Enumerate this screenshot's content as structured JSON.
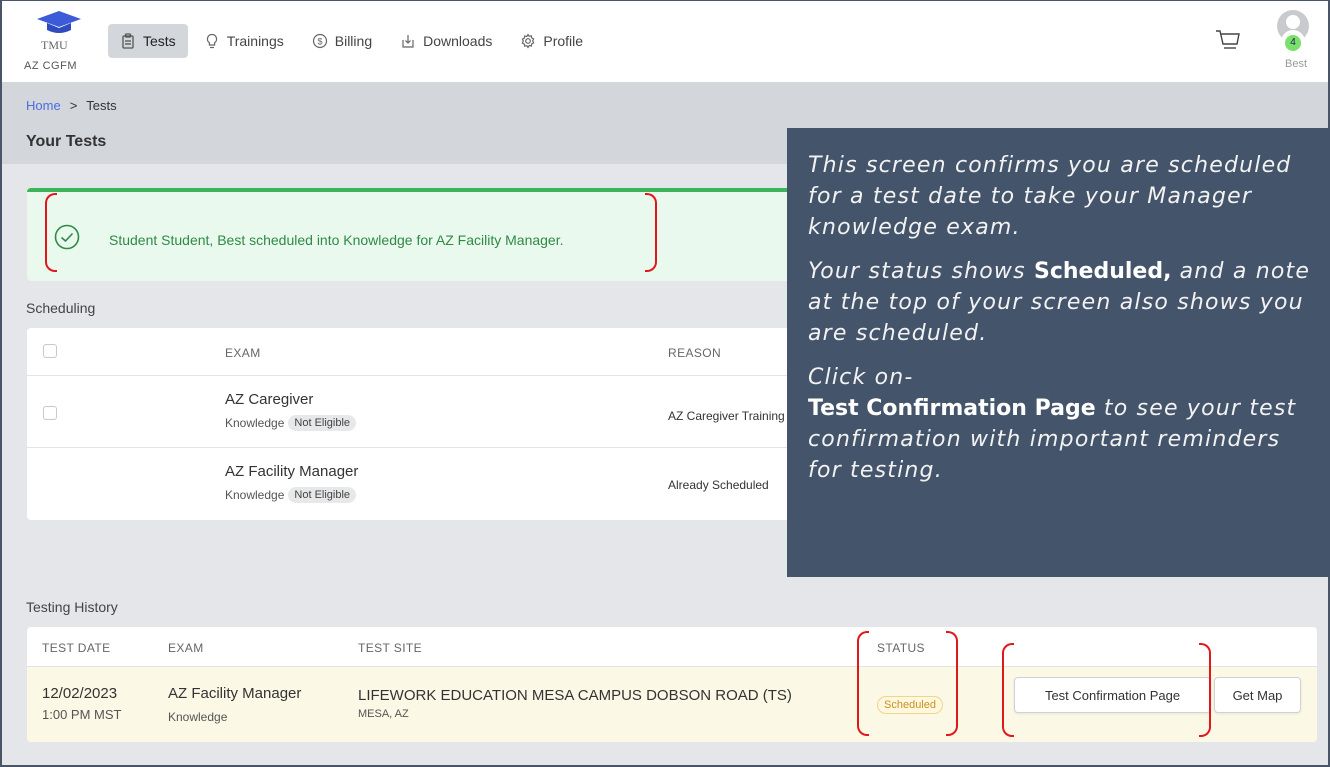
{
  "header": {
    "logo_text": "TMU",
    "org": "AZ CGFM",
    "nav": [
      {
        "label": "Tests",
        "icon": "clipboard-icon"
      },
      {
        "label": "Trainings",
        "icon": "lightbulb-icon"
      },
      {
        "label": "Billing",
        "icon": "dollar-icon"
      },
      {
        "label": "Downloads",
        "icon": "download-icon"
      },
      {
        "label": "Profile",
        "icon": "gear-icon"
      }
    ],
    "cart_count": "4",
    "user_name": "Best"
  },
  "breadcrumb": {
    "home": "Home",
    "separator": ">",
    "current": "Tests"
  },
  "page_title": "Your Tests",
  "alert": {
    "message": "Student Student, Best scheduled into Knowledge for AZ Facility Manager.",
    "color": "#3bb45a"
  },
  "scheduling": {
    "title": "Scheduling",
    "columns": {
      "exam": "EXAM",
      "reason": "REASON"
    },
    "rows": [
      {
        "exam": "AZ Caregiver",
        "type": "Knowledge",
        "eligibility": "Not Eligible",
        "reason": "AZ Caregiver Training"
      },
      {
        "exam": "AZ Facility Manager",
        "type": "Knowledge",
        "eligibility": "Not Eligible",
        "reason": "Already Scheduled"
      }
    ]
  },
  "callout": {
    "p1": "This screen confirms you are scheduled for a test date to take your Manager knowledge exam.",
    "p2_pre": "Your status shows ",
    "p2_bold": "Scheduled,",
    "p2_post": " and a note at the top of your screen also shows you are scheduled.",
    "p3_line1": "Click on-",
    "p3_bold": "Test Confirmation Page",
    "p3_post": " to see your test confirmation with important reminders for testing."
  },
  "history": {
    "title": "Testing History",
    "columns": {
      "date": "TEST DATE",
      "exam": "EXAM",
      "site": "TEST SITE",
      "status": "STATUS"
    },
    "row": {
      "date": "12/02/2023",
      "time": "1:00 PM MST",
      "exam": "AZ Facility Manager",
      "type": "Knowledge",
      "site": "LIFEWORK EDUCATION MESA CAMPUS DOBSON ROAD (TS)",
      "city": "MESA, AZ",
      "status": "Scheduled",
      "btn_confirm": "Test Confirmation Page",
      "btn_map": "Get Map"
    }
  }
}
